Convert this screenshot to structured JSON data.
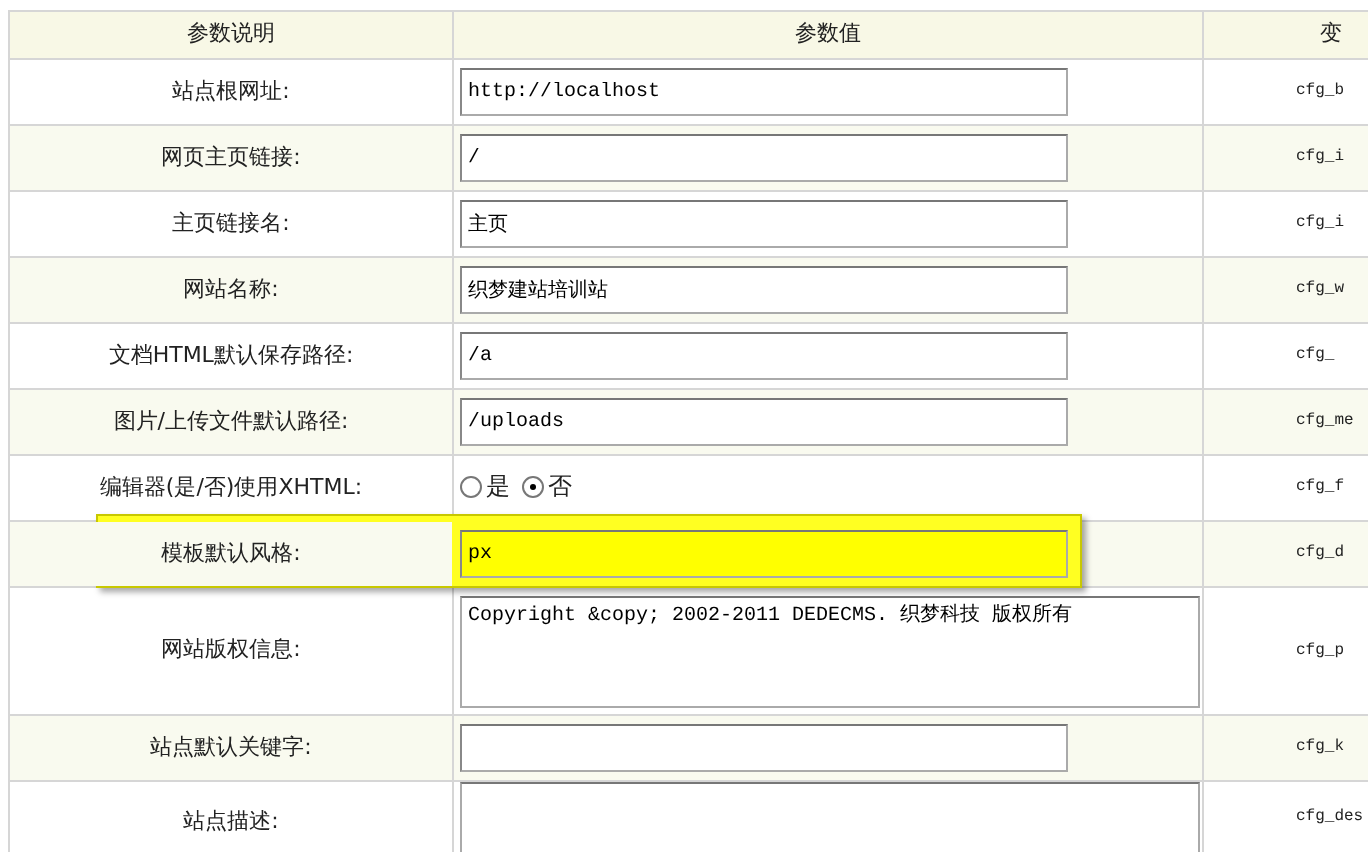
{
  "table": {
    "columns": [
      "参数说明",
      "参数值",
      "变"
    ],
    "rows": [
      {
        "kind": "text",
        "label": "站点根网址:",
        "value": "http://localhost",
        "variable": "cfg_b",
        "highlighted": false
      },
      {
        "kind": "text",
        "label": "网页主页链接:",
        "value": "/",
        "variable": "cfg_i",
        "highlighted": false
      },
      {
        "kind": "text",
        "label": "主页链接名:",
        "value": "主页",
        "variable": "cfg_i",
        "highlighted": false
      },
      {
        "kind": "text",
        "label": "网站名称:",
        "value": "织梦建站培训站",
        "variable": "cfg_w",
        "highlighted": false
      },
      {
        "kind": "text",
        "label": "文档HTML默认保存路径:",
        "value": "/a",
        "variable": "cfg_",
        "highlighted": false
      },
      {
        "kind": "text",
        "label": "图片/上传文件默认路径:",
        "value": "/uploads",
        "variable": "cfg_me",
        "highlighted": false
      },
      {
        "kind": "radio",
        "label": "编辑器(是/否)使用XHTML:",
        "options": [
          {
            "label": "是",
            "selected": false
          },
          {
            "label": "否",
            "selected": true
          }
        ],
        "variable": "cfg_f",
        "highlighted": false
      },
      {
        "kind": "text",
        "label": "模板默认风格:",
        "value": "px",
        "variable": "cfg_d",
        "highlighted": true
      },
      {
        "kind": "textarea",
        "label": "网站版权信息:",
        "value": "Copyright &copy; 2002-2011 DEDECMS. 织梦科技 版权所有",
        "variable": "cfg_p",
        "highlighted": false
      },
      {
        "kind": "text",
        "label": "站点默认关键字:",
        "value": "",
        "variable": "cfg_k",
        "highlighted": false
      },
      {
        "kind": "textarea",
        "label": "站点描述:",
        "value": "",
        "variable": "cfg_des",
        "highlighted": false
      }
    ]
  }
}
